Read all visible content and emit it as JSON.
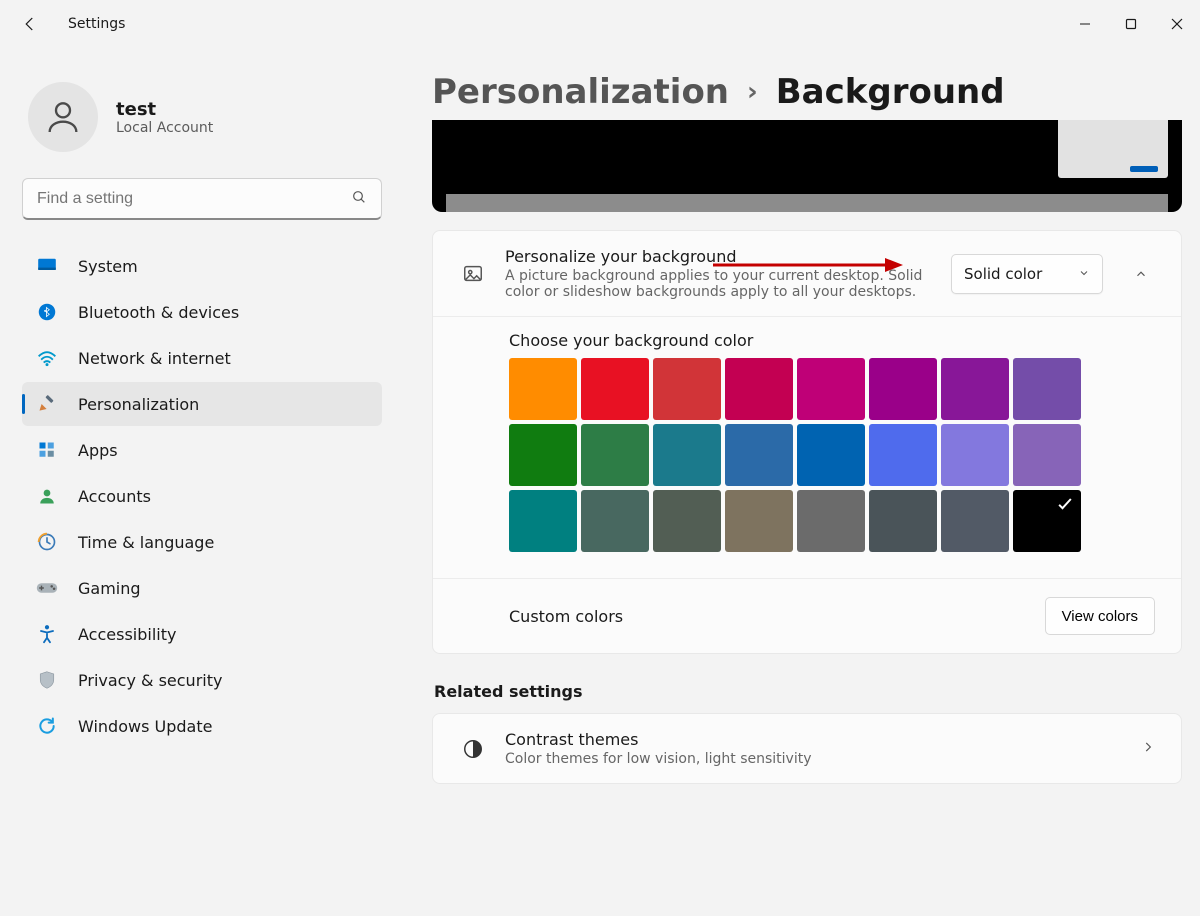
{
  "window": {
    "app_title": "Settings"
  },
  "user": {
    "name": "test",
    "subtitle": "Local Account"
  },
  "search": {
    "placeholder": "Find a setting"
  },
  "nav": [
    {
      "id": "system",
      "label": "System"
    },
    {
      "id": "bluetooth",
      "label": "Bluetooth & devices"
    },
    {
      "id": "network",
      "label": "Network & internet"
    },
    {
      "id": "personalization",
      "label": "Personalization",
      "active": true
    },
    {
      "id": "apps",
      "label": "Apps"
    },
    {
      "id": "accounts",
      "label": "Accounts"
    },
    {
      "id": "time",
      "label": "Time & language"
    },
    {
      "id": "gaming",
      "label": "Gaming"
    },
    {
      "id": "accessibility",
      "label": "Accessibility"
    },
    {
      "id": "privacy",
      "label": "Privacy & security"
    },
    {
      "id": "update",
      "label": "Windows Update"
    }
  ],
  "breadcrumb": {
    "parent": "Personalization",
    "separator": "›",
    "current": "Background"
  },
  "personalize_bg": {
    "title": "Personalize your background",
    "description": "A picture background applies to your current desktop. Solid color or slideshow backgrounds apply to all your desktops.",
    "dropdown_selected": "Solid color"
  },
  "color_section": {
    "title": "Choose your background color",
    "swatches": [
      "#ff8c00",
      "#e81123",
      "#d13438",
      "#c30052",
      "#bf0077",
      "#9a0089",
      "#881798",
      "#744da9",
      "#107c10",
      "#2d7d46",
      "#1b7a8c",
      "#2b6aa8",
      "#0063b1",
      "#4f6bed",
      "#8378de",
      "#8764b8",
      "#008080",
      "#486860",
      "#525e54",
      "#7e735f",
      "#6b6b6b",
      "#4a5459",
      "#525a66",
      "#000000"
    ],
    "selected_index": 23
  },
  "custom_colors": {
    "label": "Custom colors",
    "button": "View colors"
  },
  "related": {
    "heading": "Related settings",
    "contrast_title": "Contrast themes",
    "contrast_desc": "Color themes for low vision, light sensitivity"
  }
}
